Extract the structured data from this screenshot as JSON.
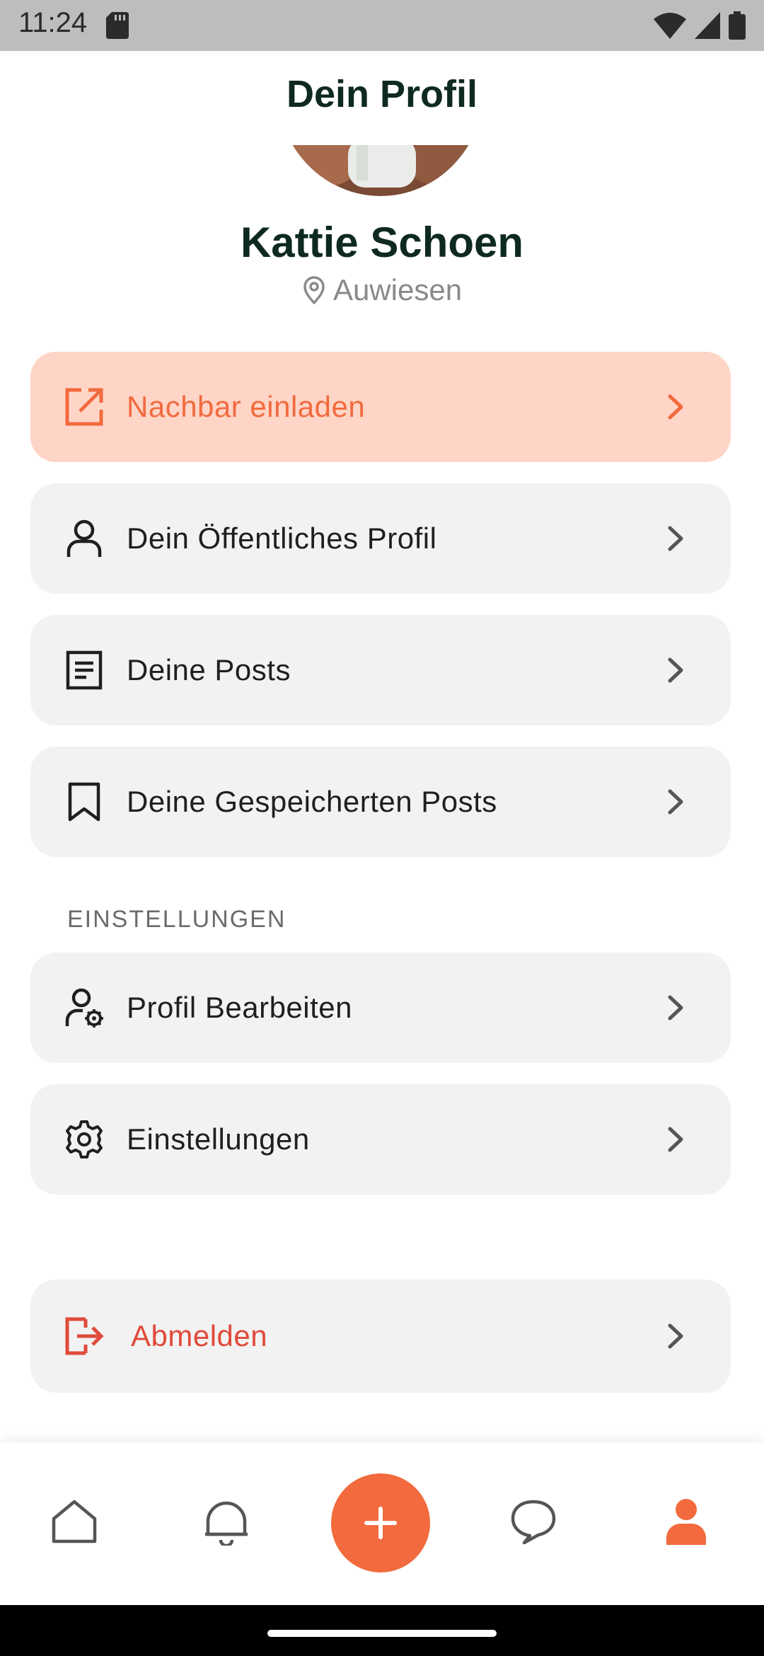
{
  "status_bar": {
    "time": "11:24"
  },
  "header": {
    "title": "Dein Profil"
  },
  "profile": {
    "name": "Kattie Schoen",
    "location": "Auwiesen"
  },
  "menu": {
    "invite": "Nachbar einladen",
    "public_profile": "Dein Öffentliches Profil",
    "posts": "Deine Posts",
    "saved_posts": "Deine Gespeicherten Posts"
  },
  "settings_section": {
    "title": "EINSTELLUNGEN",
    "edit_profile": "Profil Bearbeiten",
    "settings": "Einstellungen"
  },
  "logout": "Abmelden",
  "colors": {
    "accent": "#f26a3d",
    "invite_bg": "#ffd5c7",
    "card_bg": "#f2f2f2",
    "logout": "#e04a3a",
    "title": "#0e2a1f"
  },
  "bottom_nav": {
    "items": [
      "home-icon",
      "bell-icon",
      "plus-icon",
      "chat-icon",
      "person-icon"
    ],
    "active": "person-icon"
  }
}
